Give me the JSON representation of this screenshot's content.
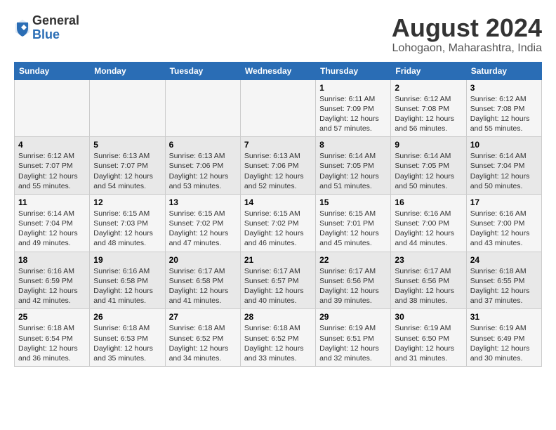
{
  "logo": {
    "general": "General",
    "blue": "Blue"
  },
  "title": "August 2024",
  "subtitle": "Lohogaon, Maharashtra, India",
  "days_of_week": [
    "Sunday",
    "Monday",
    "Tuesday",
    "Wednesday",
    "Thursday",
    "Friday",
    "Saturday"
  ],
  "weeks": [
    [
      {
        "day": "",
        "info": ""
      },
      {
        "day": "",
        "info": ""
      },
      {
        "day": "",
        "info": ""
      },
      {
        "day": "",
        "info": ""
      },
      {
        "day": "1",
        "info": "Sunrise: 6:11 AM\nSunset: 7:09 PM\nDaylight: 12 hours\nand 57 minutes."
      },
      {
        "day": "2",
        "info": "Sunrise: 6:12 AM\nSunset: 7:08 PM\nDaylight: 12 hours\nand 56 minutes."
      },
      {
        "day": "3",
        "info": "Sunrise: 6:12 AM\nSunset: 7:08 PM\nDaylight: 12 hours\nand 55 minutes."
      }
    ],
    [
      {
        "day": "4",
        "info": "Sunrise: 6:12 AM\nSunset: 7:07 PM\nDaylight: 12 hours\nand 55 minutes."
      },
      {
        "day": "5",
        "info": "Sunrise: 6:13 AM\nSunset: 7:07 PM\nDaylight: 12 hours\nand 54 minutes."
      },
      {
        "day": "6",
        "info": "Sunrise: 6:13 AM\nSunset: 7:06 PM\nDaylight: 12 hours\nand 53 minutes."
      },
      {
        "day": "7",
        "info": "Sunrise: 6:13 AM\nSunset: 7:06 PM\nDaylight: 12 hours\nand 52 minutes."
      },
      {
        "day": "8",
        "info": "Sunrise: 6:14 AM\nSunset: 7:05 PM\nDaylight: 12 hours\nand 51 minutes."
      },
      {
        "day": "9",
        "info": "Sunrise: 6:14 AM\nSunset: 7:05 PM\nDaylight: 12 hours\nand 50 minutes."
      },
      {
        "day": "10",
        "info": "Sunrise: 6:14 AM\nSunset: 7:04 PM\nDaylight: 12 hours\nand 50 minutes."
      }
    ],
    [
      {
        "day": "11",
        "info": "Sunrise: 6:14 AM\nSunset: 7:04 PM\nDaylight: 12 hours\nand 49 minutes."
      },
      {
        "day": "12",
        "info": "Sunrise: 6:15 AM\nSunset: 7:03 PM\nDaylight: 12 hours\nand 48 minutes."
      },
      {
        "day": "13",
        "info": "Sunrise: 6:15 AM\nSunset: 7:02 PM\nDaylight: 12 hours\nand 47 minutes."
      },
      {
        "day": "14",
        "info": "Sunrise: 6:15 AM\nSunset: 7:02 PM\nDaylight: 12 hours\nand 46 minutes."
      },
      {
        "day": "15",
        "info": "Sunrise: 6:15 AM\nSunset: 7:01 PM\nDaylight: 12 hours\nand 45 minutes."
      },
      {
        "day": "16",
        "info": "Sunrise: 6:16 AM\nSunset: 7:00 PM\nDaylight: 12 hours\nand 44 minutes."
      },
      {
        "day": "17",
        "info": "Sunrise: 6:16 AM\nSunset: 7:00 PM\nDaylight: 12 hours\nand 43 minutes."
      }
    ],
    [
      {
        "day": "18",
        "info": "Sunrise: 6:16 AM\nSunset: 6:59 PM\nDaylight: 12 hours\nand 42 minutes."
      },
      {
        "day": "19",
        "info": "Sunrise: 6:16 AM\nSunset: 6:58 PM\nDaylight: 12 hours\nand 41 minutes."
      },
      {
        "day": "20",
        "info": "Sunrise: 6:17 AM\nSunset: 6:58 PM\nDaylight: 12 hours\nand 41 minutes."
      },
      {
        "day": "21",
        "info": "Sunrise: 6:17 AM\nSunset: 6:57 PM\nDaylight: 12 hours\nand 40 minutes."
      },
      {
        "day": "22",
        "info": "Sunrise: 6:17 AM\nSunset: 6:56 PM\nDaylight: 12 hours\nand 39 minutes."
      },
      {
        "day": "23",
        "info": "Sunrise: 6:17 AM\nSunset: 6:56 PM\nDaylight: 12 hours\nand 38 minutes."
      },
      {
        "day": "24",
        "info": "Sunrise: 6:18 AM\nSunset: 6:55 PM\nDaylight: 12 hours\nand 37 minutes."
      }
    ],
    [
      {
        "day": "25",
        "info": "Sunrise: 6:18 AM\nSunset: 6:54 PM\nDaylight: 12 hours\nand 36 minutes."
      },
      {
        "day": "26",
        "info": "Sunrise: 6:18 AM\nSunset: 6:53 PM\nDaylight: 12 hours\nand 35 minutes."
      },
      {
        "day": "27",
        "info": "Sunrise: 6:18 AM\nSunset: 6:52 PM\nDaylight: 12 hours\nand 34 minutes."
      },
      {
        "day": "28",
        "info": "Sunrise: 6:18 AM\nSunset: 6:52 PM\nDaylight: 12 hours\nand 33 minutes."
      },
      {
        "day": "29",
        "info": "Sunrise: 6:19 AM\nSunset: 6:51 PM\nDaylight: 12 hours\nand 32 minutes."
      },
      {
        "day": "30",
        "info": "Sunrise: 6:19 AM\nSunset: 6:50 PM\nDaylight: 12 hours\nand 31 minutes."
      },
      {
        "day": "31",
        "info": "Sunrise: 6:19 AM\nSunset: 6:49 PM\nDaylight: 12 hours\nand 30 minutes."
      }
    ]
  ]
}
